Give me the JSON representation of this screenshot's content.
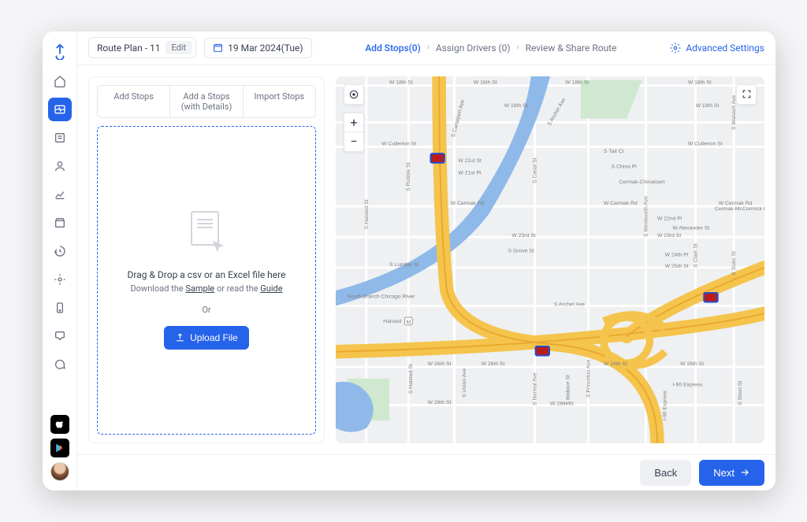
{
  "topbar": {
    "plan_name": "Route Plan - 11",
    "edit_label": "Edit",
    "date_label": "19 Mar 2024(Tue)"
  },
  "breadcrumbs": {
    "step1": "Add Stops(0)",
    "step2": "Assign Drivers (0)",
    "step3": "Review & Share Route"
  },
  "advanced_settings_label": "Advanced Settings",
  "tabs": {
    "add": "Add Stops",
    "add_details": "Add a Stops (with Details)",
    "import": "Import Stops"
  },
  "dropzone": {
    "title": "Drag & Drop a csv or an Excel file here",
    "download_prefix": "Download the ",
    "sample_link": "Sample",
    "middle": " or read the ",
    "guide_link": "Guide",
    "or": "Or",
    "upload_button": "Upload File"
  },
  "footer": {
    "back": "Back",
    "next": "Next"
  },
  "map": {
    "river_label": "South Branch Chicago River",
    "streets": {
      "w18th": "W 18th St",
      "w19th": "W 19th St",
      "wcullerton": "W Cullerton St",
      "w21st": "W 21st St",
      "w21stpl": "W 21st Pl",
      "wcermak": "W Cermak Rd",
      "w22nd": "W 22nd Pl",
      "w23rd": "W 23rd St",
      "walexander": "W Alexander St",
      "w24th": "W 24th Pl",
      "w25th": "W 25th St",
      "w26th": "W 26th St",
      "w28th": "W 28th St",
      "cermak_chinatown": "Cermak-Chinatown",
      "cermak_mccormick": "Cermak-McCormick Place",
      "halsted": "Halsted",
      "stait": "S Tait Ct",
      "schina": "S China Pl",
      "sarcher": "S Archer Ave",
      "slumber": "S Lumber St",
      "sgrove": "S Grove St",
      "shalsted": "S Halsted St",
      "scanalport": "S Canalport Ave",
      "scanal": "S Canal St",
      "snormal": "S Normal Ave",
      "swentworth": "S Wentworth Ave",
      "sprinceton": "S Princeton Ave",
      "swallace": "S Wallace St",
      "swabash": "S Wabash Ave",
      "sstate": "S State St",
      "sclark": "S Clark St",
      "sunion": "S Union Ave",
      "i90": "I-90 Express",
      "srubble": "S Rubble St",
      "sshort": "S Short St"
    }
  }
}
